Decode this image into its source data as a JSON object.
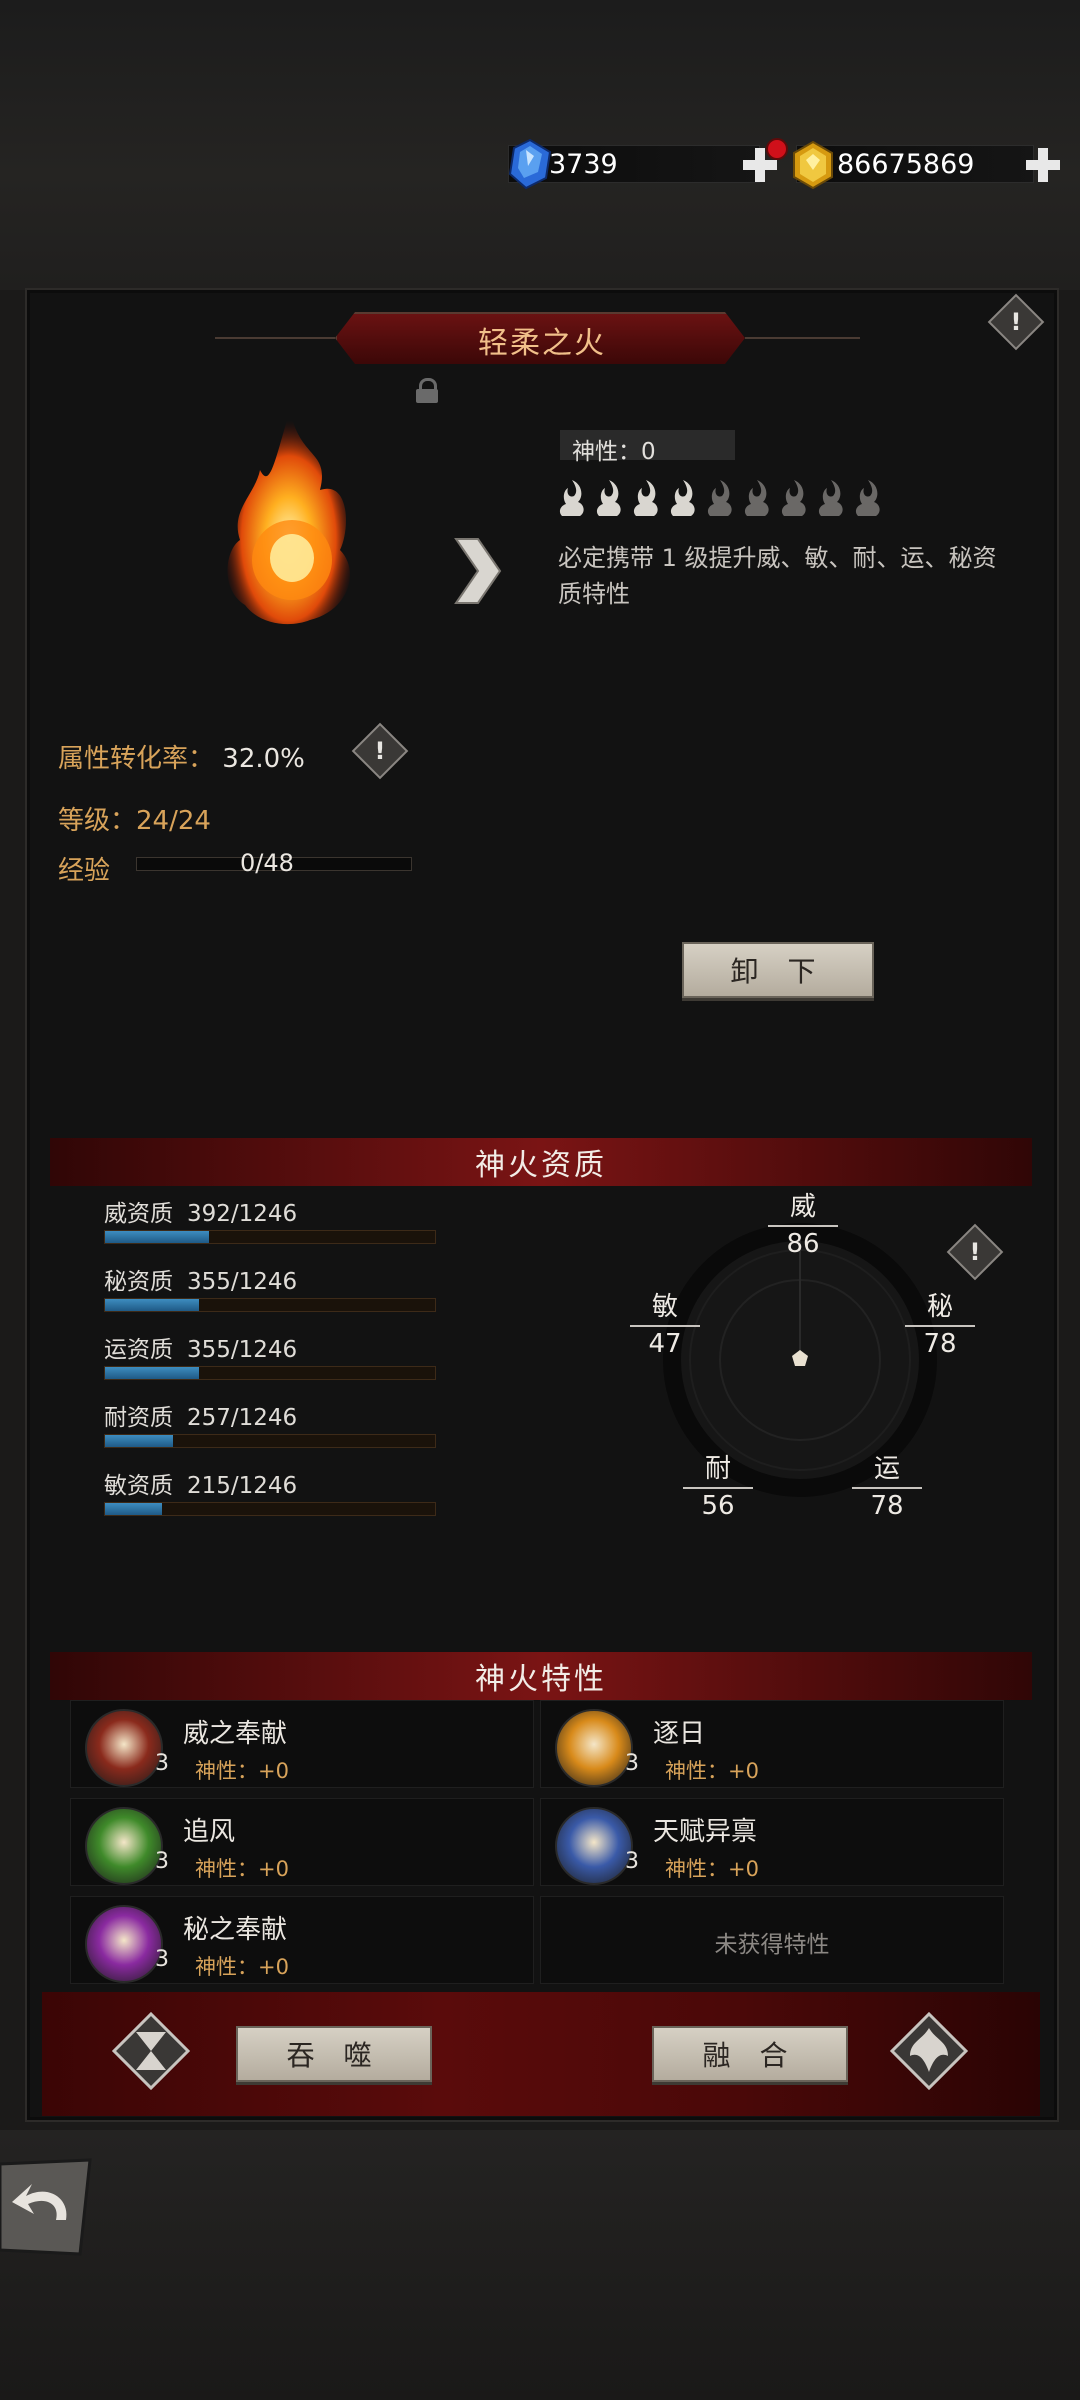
{
  "currency": {
    "gems": "3739",
    "gold": "86675869"
  },
  "fire": {
    "name": "轻柔之火",
    "divinity_label": "神性：0",
    "divinity_pips_filled": 4,
    "divinity_pips_total": 9,
    "description": "必定携带 1 级提升威、敏、耐、运、秘资质特性"
  },
  "stats": {
    "conversion_label": "属性转化率：",
    "conversion_value": "32.0%",
    "level_label": "等级：24/24",
    "exp_label": "经验",
    "exp_value": "0/48",
    "exp_fraction": 0
  },
  "buttons": {
    "unequip": "卸 下",
    "devour": "吞 噬",
    "fuse": "融 合"
  },
  "aptitude": {
    "header": "神火资质",
    "rows": [
      {
        "label": "威资质",
        "value": "392/1246",
        "fraction": 0.315
      },
      {
        "label": "秘资质",
        "value": "355/1246",
        "fraction": 0.285
      },
      {
        "label": "运资质",
        "value": "355/1246",
        "fraction": 0.285
      },
      {
        "label": "耐资质",
        "value": "257/1246",
        "fraction": 0.206
      },
      {
        "label": "敏资质",
        "value": "215/1246",
        "fraction": 0.173
      }
    ],
    "radar": {
      "wei": {
        "label": "威",
        "value": "86"
      },
      "mi": {
        "label": "秘",
        "value": "78"
      },
      "yun": {
        "label": "运",
        "value": "78"
      },
      "nai": {
        "label": "耐",
        "value": "56"
      },
      "min": {
        "label": "敏",
        "value": "47"
      }
    }
  },
  "traits": {
    "header": "神火特性",
    "items": [
      {
        "name": "威之奉献",
        "level": "3",
        "divinity": "神性：+0",
        "icon": "fan-icon",
        "color": "#8a2a1c"
      },
      {
        "name": "逐日",
        "level": "3",
        "divinity": "神性：+0",
        "icon": "sun-chase-icon",
        "color": "#d88a1a"
      },
      {
        "name": "追风",
        "level": "3",
        "divinity": "神性：+0",
        "icon": "wind-icon",
        "color": "#3f8a2a"
      },
      {
        "name": "天赋异禀",
        "level": "3",
        "divinity": "神性：+0",
        "icon": "pentagon-crystal-icon",
        "color": "#3a5aa8"
      },
      {
        "name": "秘之奉献",
        "level": "3",
        "divinity": "神性：+0",
        "icon": "arcane-icon",
        "color": "#8a2aa0"
      }
    ],
    "empty_label": "未获得特性"
  }
}
